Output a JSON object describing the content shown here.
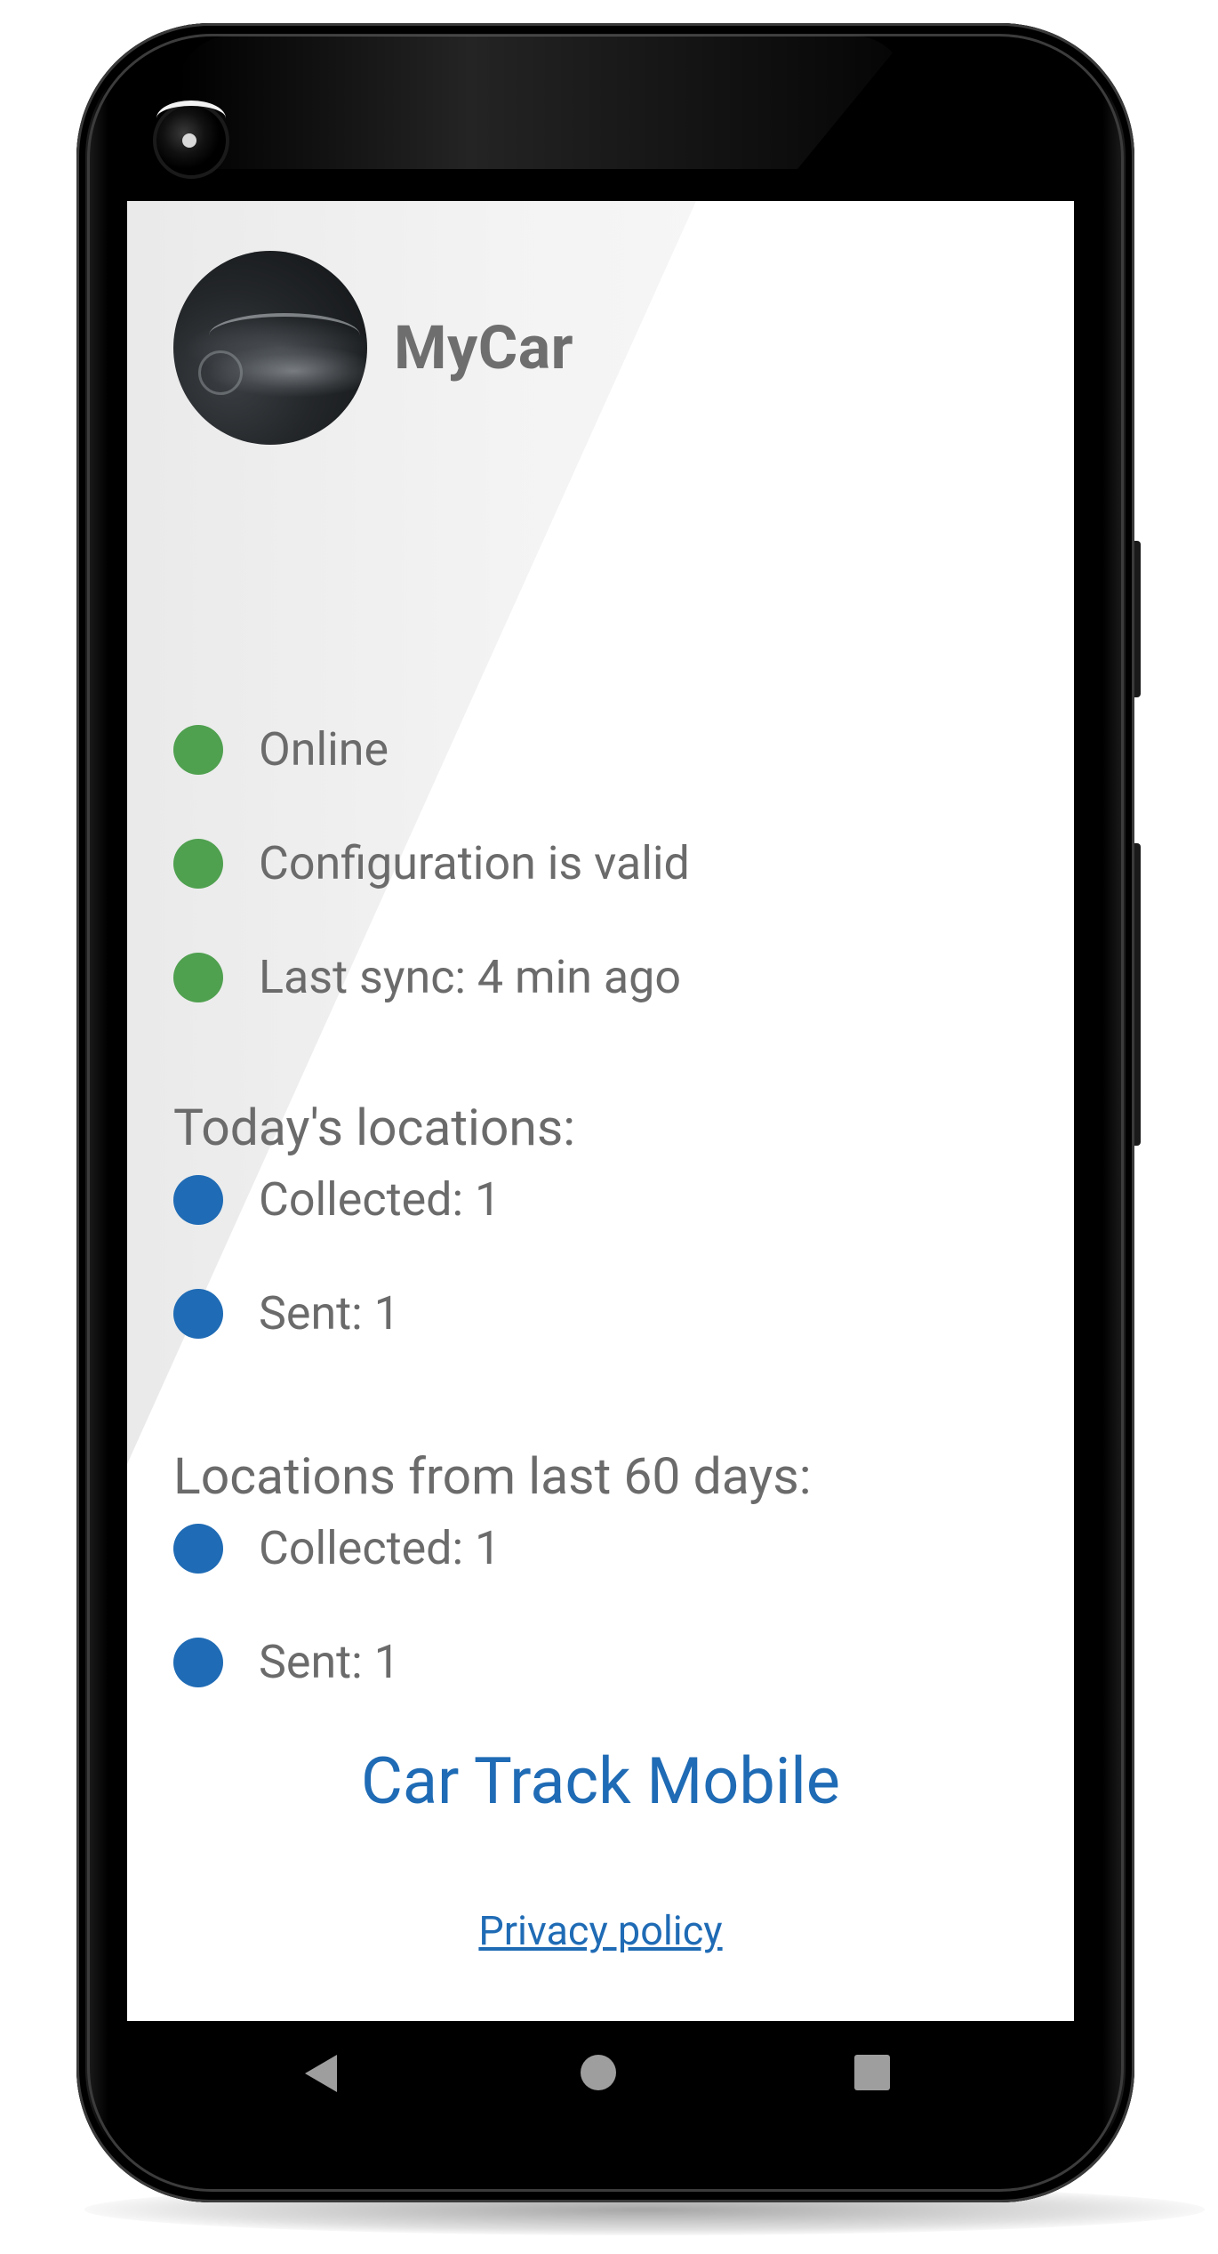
{
  "app": {
    "car_name": "MyCar",
    "title": "Car Track Mobile",
    "privacy_label": "Privacy policy"
  },
  "status": [
    {
      "label": "Online",
      "color": "#4fa04f"
    },
    {
      "label": "Configuration is valid",
      "color": "#4fa04f"
    },
    {
      "label": "Last sync: 4 min ago",
      "color": "#4fa04f"
    }
  ],
  "today": {
    "title": "Today's locations:",
    "collected": "Collected: 1",
    "sent": "Sent: 1",
    "color": "#1f6bb5"
  },
  "last60": {
    "title": "Locations from last 60 days:",
    "collected": "Collected: 1",
    "sent": "Sent: 1",
    "color": "#1f6bb5"
  },
  "navbar": {
    "back": "back-icon",
    "home": "home-icon",
    "recents": "recents-icon"
  }
}
